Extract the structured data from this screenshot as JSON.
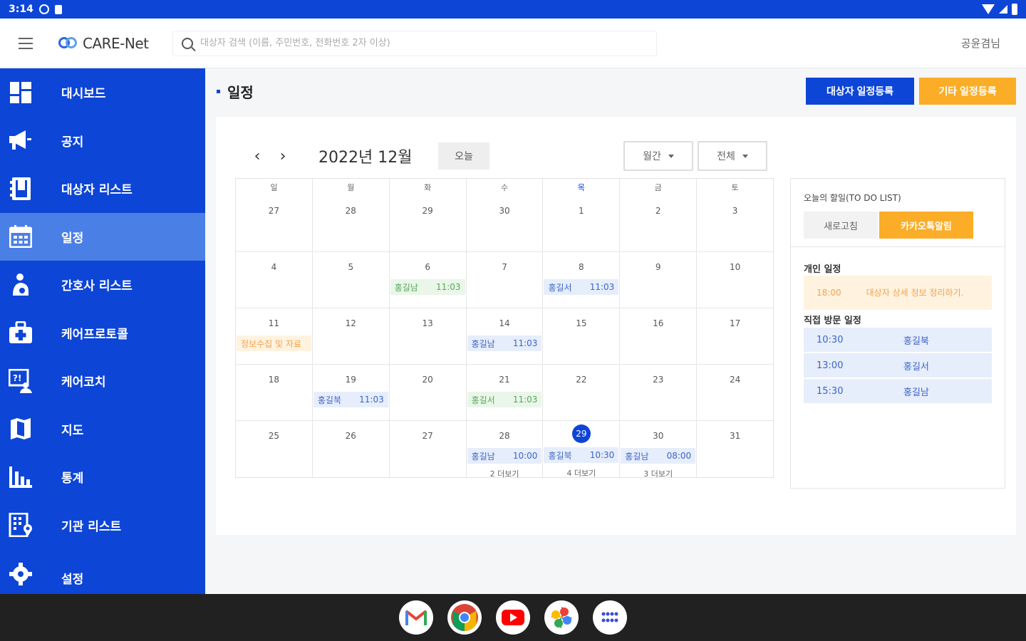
{
  "status_bar": {
    "time": "3:14"
  },
  "app": {
    "logo_text": "CARE-Net",
    "user": "공윤겸님"
  },
  "search": {
    "placeholder": "대상자 검색 (이름, 주민번호, 전화번호 2자 이상)"
  },
  "sidebar": {
    "items": [
      {
        "label": "대시보드",
        "icon": "dashboard-icon"
      },
      {
        "label": "공지",
        "icon": "megaphone-icon"
      },
      {
        "label": "대상자 리스트",
        "icon": "contacts-icon"
      },
      {
        "label": "일정",
        "icon": "calendar-icon",
        "active": true
      },
      {
        "label": "간호사 리스트",
        "icon": "nurse-icon"
      },
      {
        "label": "케어프로토콜",
        "icon": "medical-bag-icon"
      },
      {
        "label": "케어코치",
        "icon": "coach-icon"
      },
      {
        "label": "지도",
        "icon": "map-icon"
      },
      {
        "label": "통계",
        "icon": "chart-icon"
      },
      {
        "label": "기관 리스트",
        "icon": "building-icon"
      },
      {
        "label": "설정",
        "icon": "gear-icon"
      }
    ]
  },
  "page": {
    "title": "일정",
    "btn_subject_register": "대상자 일정등록",
    "btn_other_register": "기타 일정등록"
  },
  "calendar": {
    "month_title": "2022년 12월",
    "today_label": "오늘",
    "view_select": "월간",
    "filter_select": "전체",
    "weekdays": [
      "일",
      "월",
      "화",
      "수",
      "목",
      "금",
      "토"
    ],
    "weeks": [
      {
        "days": [
          {
            "n": "27"
          },
          {
            "n": "28"
          },
          {
            "n": "29"
          },
          {
            "n": "30"
          },
          {
            "n": "1"
          },
          {
            "n": "2"
          },
          {
            "n": "3"
          }
        ]
      },
      {
        "days": [
          {
            "n": "4"
          },
          {
            "n": "5"
          },
          {
            "n": "6",
            "ev": {
              "name": "홍길남",
              "time": "11:03",
              "color": "green"
            }
          },
          {
            "n": "7"
          },
          {
            "n": "8",
            "ev": {
              "name": "홍길서",
              "time": "11:03",
              "color": "blue"
            }
          },
          {
            "n": "9"
          },
          {
            "n": "10"
          }
        ]
      },
      {
        "days": [
          {
            "n": "11",
            "ev": {
              "name": "정보수집 및 자료",
              "time": "",
              "color": "orange"
            }
          },
          {
            "n": "12"
          },
          {
            "n": "13"
          },
          {
            "n": "14",
            "ev": {
              "name": "홍길남",
              "time": "11:03",
              "color": "blue"
            }
          },
          {
            "n": "15"
          },
          {
            "n": "16"
          },
          {
            "n": "17"
          }
        ]
      },
      {
        "days": [
          {
            "n": "18"
          },
          {
            "n": "19",
            "ev": {
              "name": "홍길북",
              "time": "11:03",
              "color": "blue"
            }
          },
          {
            "n": "20"
          },
          {
            "n": "21",
            "ev": {
              "name": "홍길서",
              "time": "11:03",
              "color": "green"
            }
          },
          {
            "n": "22"
          },
          {
            "n": "23"
          },
          {
            "n": "24"
          }
        ]
      },
      {
        "days": [
          {
            "n": "25"
          },
          {
            "n": "26"
          },
          {
            "n": "27"
          },
          {
            "n": "28",
            "ev": {
              "name": "홍길남",
              "time": "10:00",
              "color": "blue"
            },
            "more": "2 더보기"
          },
          {
            "n": "29",
            "today": true,
            "ev": {
              "name": "홍길북",
              "time": "10:30",
              "color": "blue"
            },
            "more": "4 더보기"
          },
          {
            "n": "30",
            "ev": {
              "name": "홍길남",
              "time": "08:00",
              "color": "blue"
            },
            "more": "3 더보기"
          },
          {
            "n": "31"
          }
        ]
      }
    ]
  },
  "todo": {
    "title": "오늘의 할일(TO DO LIST)",
    "refresh": "새로고침",
    "kakao": "카카오톡알림",
    "personal_label": "개인 일정",
    "personal": {
      "time": "18:00",
      "text": "대상자 상세 정보 정리하기."
    },
    "visit_label": "직접 방문 일정",
    "visits": [
      {
        "time": "10:30",
        "name": "홍길북"
      },
      {
        "time": "13:00",
        "name": "홍길서"
      },
      {
        "time": "15:30",
        "name": "홍길남"
      }
    ]
  },
  "dock": [
    "gmail-icon",
    "chrome-icon",
    "youtube-icon",
    "photos-icon",
    "app-drawer-icon"
  ]
}
